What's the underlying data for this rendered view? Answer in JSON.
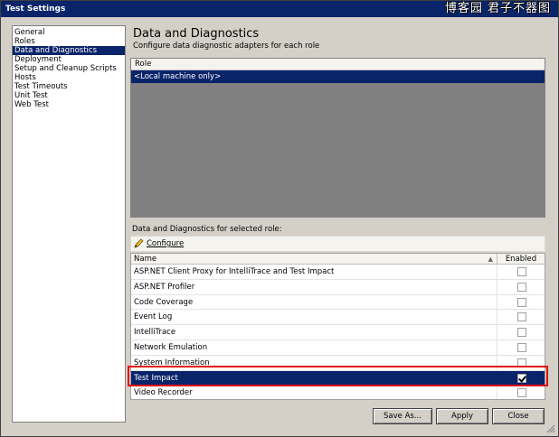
{
  "window": {
    "title": "Test Settings",
    "watermark": "博客园 君子不器图"
  },
  "sidebar": {
    "items": [
      {
        "label": "General",
        "selected": false
      },
      {
        "label": "Roles",
        "selected": false
      },
      {
        "label": "Data and Diagnostics",
        "selected": true
      },
      {
        "label": "Deployment",
        "selected": false
      },
      {
        "label": "Setup and Cleanup Scripts",
        "selected": false
      },
      {
        "label": "Hosts",
        "selected": false
      },
      {
        "label": "Test Timeouts",
        "selected": false
      },
      {
        "label": "Unit Test",
        "selected": false
      },
      {
        "label": "Web Test",
        "selected": false
      }
    ]
  },
  "main": {
    "title": "Data and Diagnostics",
    "subtitle": "Configure data diagnostic adapters for each role",
    "roles": {
      "header": "Role",
      "rows": [
        "<Local machine only>"
      ]
    },
    "diagnostics_label": "Data and Diagnostics for selected role:",
    "configure_label": "Configure",
    "adapters": {
      "col_name": "Name",
      "col_enabled": "Enabled",
      "rows": [
        {
          "name": "ASP.NET Client Proxy for IntelliTrace and Test Impact",
          "enabled": false
        },
        {
          "name": "ASP.NET Profiler",
          "enabled": false
        },
        {
          "name": "Code Coverage",
          "enabled": false
        },
        {
          "name": "Event Log",
          "enabled": false
        },
        {
          "name": "IntelliTrace",
          "enabled": false
        },
        {
          "name": "Network Emulation",
          "enabled": false
        },
        {
          "name": "System Information",
          "enabled": false
        },
        {
          "name": "Test Impact",
          "enabled": true,
          "selected": true
        },
        {
          "name": "Video Recorder",
          "enabled": false
        }
      ]
    }
  },
  "footer": {
    "save_as": "Save As...",
    "apply": "Apply",
    "close": "Close"
  },
  "colors": {
    "selection": "#0a246a",
    "highlight_outline": "#e01010",
    "dialog_bg": "#d4d0c8"
  }
}
